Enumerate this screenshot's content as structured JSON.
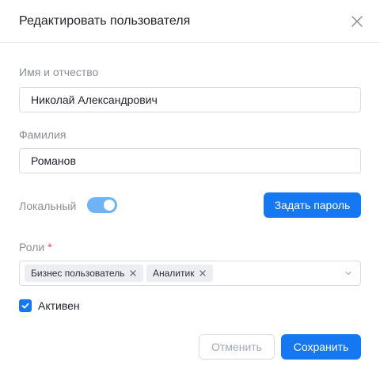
{
  "dialog": {
    "title": "Редактировать пользователя"
  },
  "form": {
    "first_name_label": "Имя и отчество",
    "first_name_value": "Николай Александрович",
    "last_name_label": "Фамилия",
    "last_name_value": "Романов",
    "local_label": "Локальный",
    "local_enabled": true,
    "set_password_label": "Задать пароль",
    "roles_label": "Роли",
    "roles_required_mark": "*",
    "roles": [
      "Бизнес пользователь",
      "Аналитик"
    ],
    "active_label": "Активен",
    "active_checked": true
  },
  "footer": {
    "cancel_label": "Отменить",
    "save_label": "Сохранить"
  },
  "colors": {
    "primary": "#1677f2",
    "toggle_on": "#6fb3f7",
    "required": "#e5484d"
  },
  "icons": {
    "close": "close-icon",
    "tag_remove": "close-icon",
    "select_open": "chevron-down-icon",
    "checkbox": "check-icon"
  }
}
